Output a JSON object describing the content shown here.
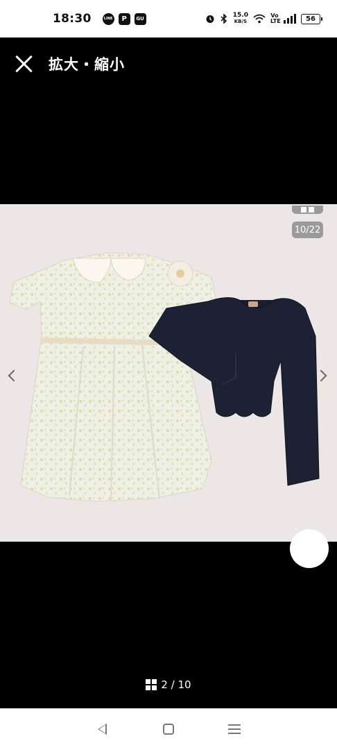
{
  "status_bar": {
    "time": "18:30",
    "notifications": [
      "LINE",
      "P",
      "GU"
    ],
    "speed_value": "15.0",
    "speed_unit": "KB/S",
    "network": "Vo LTE",
    "battery": "56"
  },
  "header": {
    "close_icon": "close-icon",
    "title": "拡大・縮小"
  },
  "viewer": {
    "image_description_only": "",
    "counter": "10/22",
    "background_color": "#ece6e6"
  },
  "pager": {
    "current": "2",
    "separator": "/",
    "total": "10",
    "text": "2 / 10"
  },
  "nav_bar": {
    "back_icon": "back-icon",
    "home_icon": "home-icon",
    "recents_icon": "recents-icon"
  }
}
